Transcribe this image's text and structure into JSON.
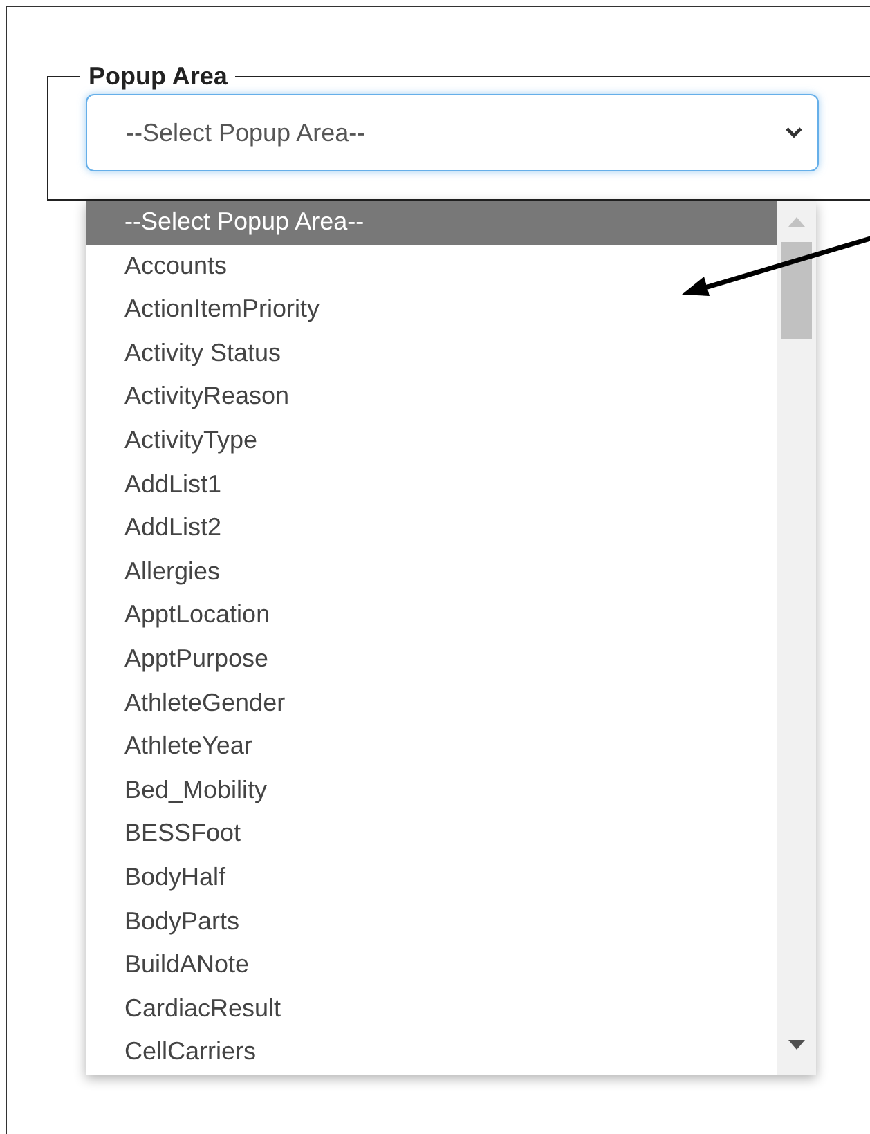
{
  "fieldset": {
    "legend": "Popup Area"
  },
  "select": {
    "value": "--Select Popup Area--",
    "expanded": true
  },
  "options": [
    {
      "label": "--Select Popup Area--",
      "selected": true
    },
    {
      "label": "Accounts",
      "selected": false
    },
    {
      "label": "ActionItemPriority",
      "selected": false
    },
    {
      "label": "Activity Status",
      "selected": false
    },
    {
      "label": "ActivityReason",
      "selected": false
    },
    {
      "label": "ActivityType",
      "selected": false
    },
    {
      "label": "AddList1",
      "selected": false
    },
    {
      "label": "AddList2",
      "selected": false
    },
    {
      "label": "Allergies",
      "selected": false
    },
    {
      "label": "ApptLocation",
      "selected": false
    },
    {
      "label": "ApptPurpose",
      "selected": false
    },
    {
      "label": "AthleteGender",
      "selected": false
    },
    {
      "label": "AthleteYear",
      "selected": false
    },
    {
      "label": "Bed_Mobility",
      "selected": false
    },
    {
      "label": "BESSFoot",
      "selected": false
    },
    {
      "label": "BodyHalf",
      "selected": false
    },
    {
      "label": "BodyParts",
      "selected": false
    },
    {
      "label": "BuildANote",
      "selected": false
    },
    {
      "label": "CardiacResult",
      "selected": false
    },
    {
      "label": "CellCarriers",
      "selected": false
    }
  ]
}
